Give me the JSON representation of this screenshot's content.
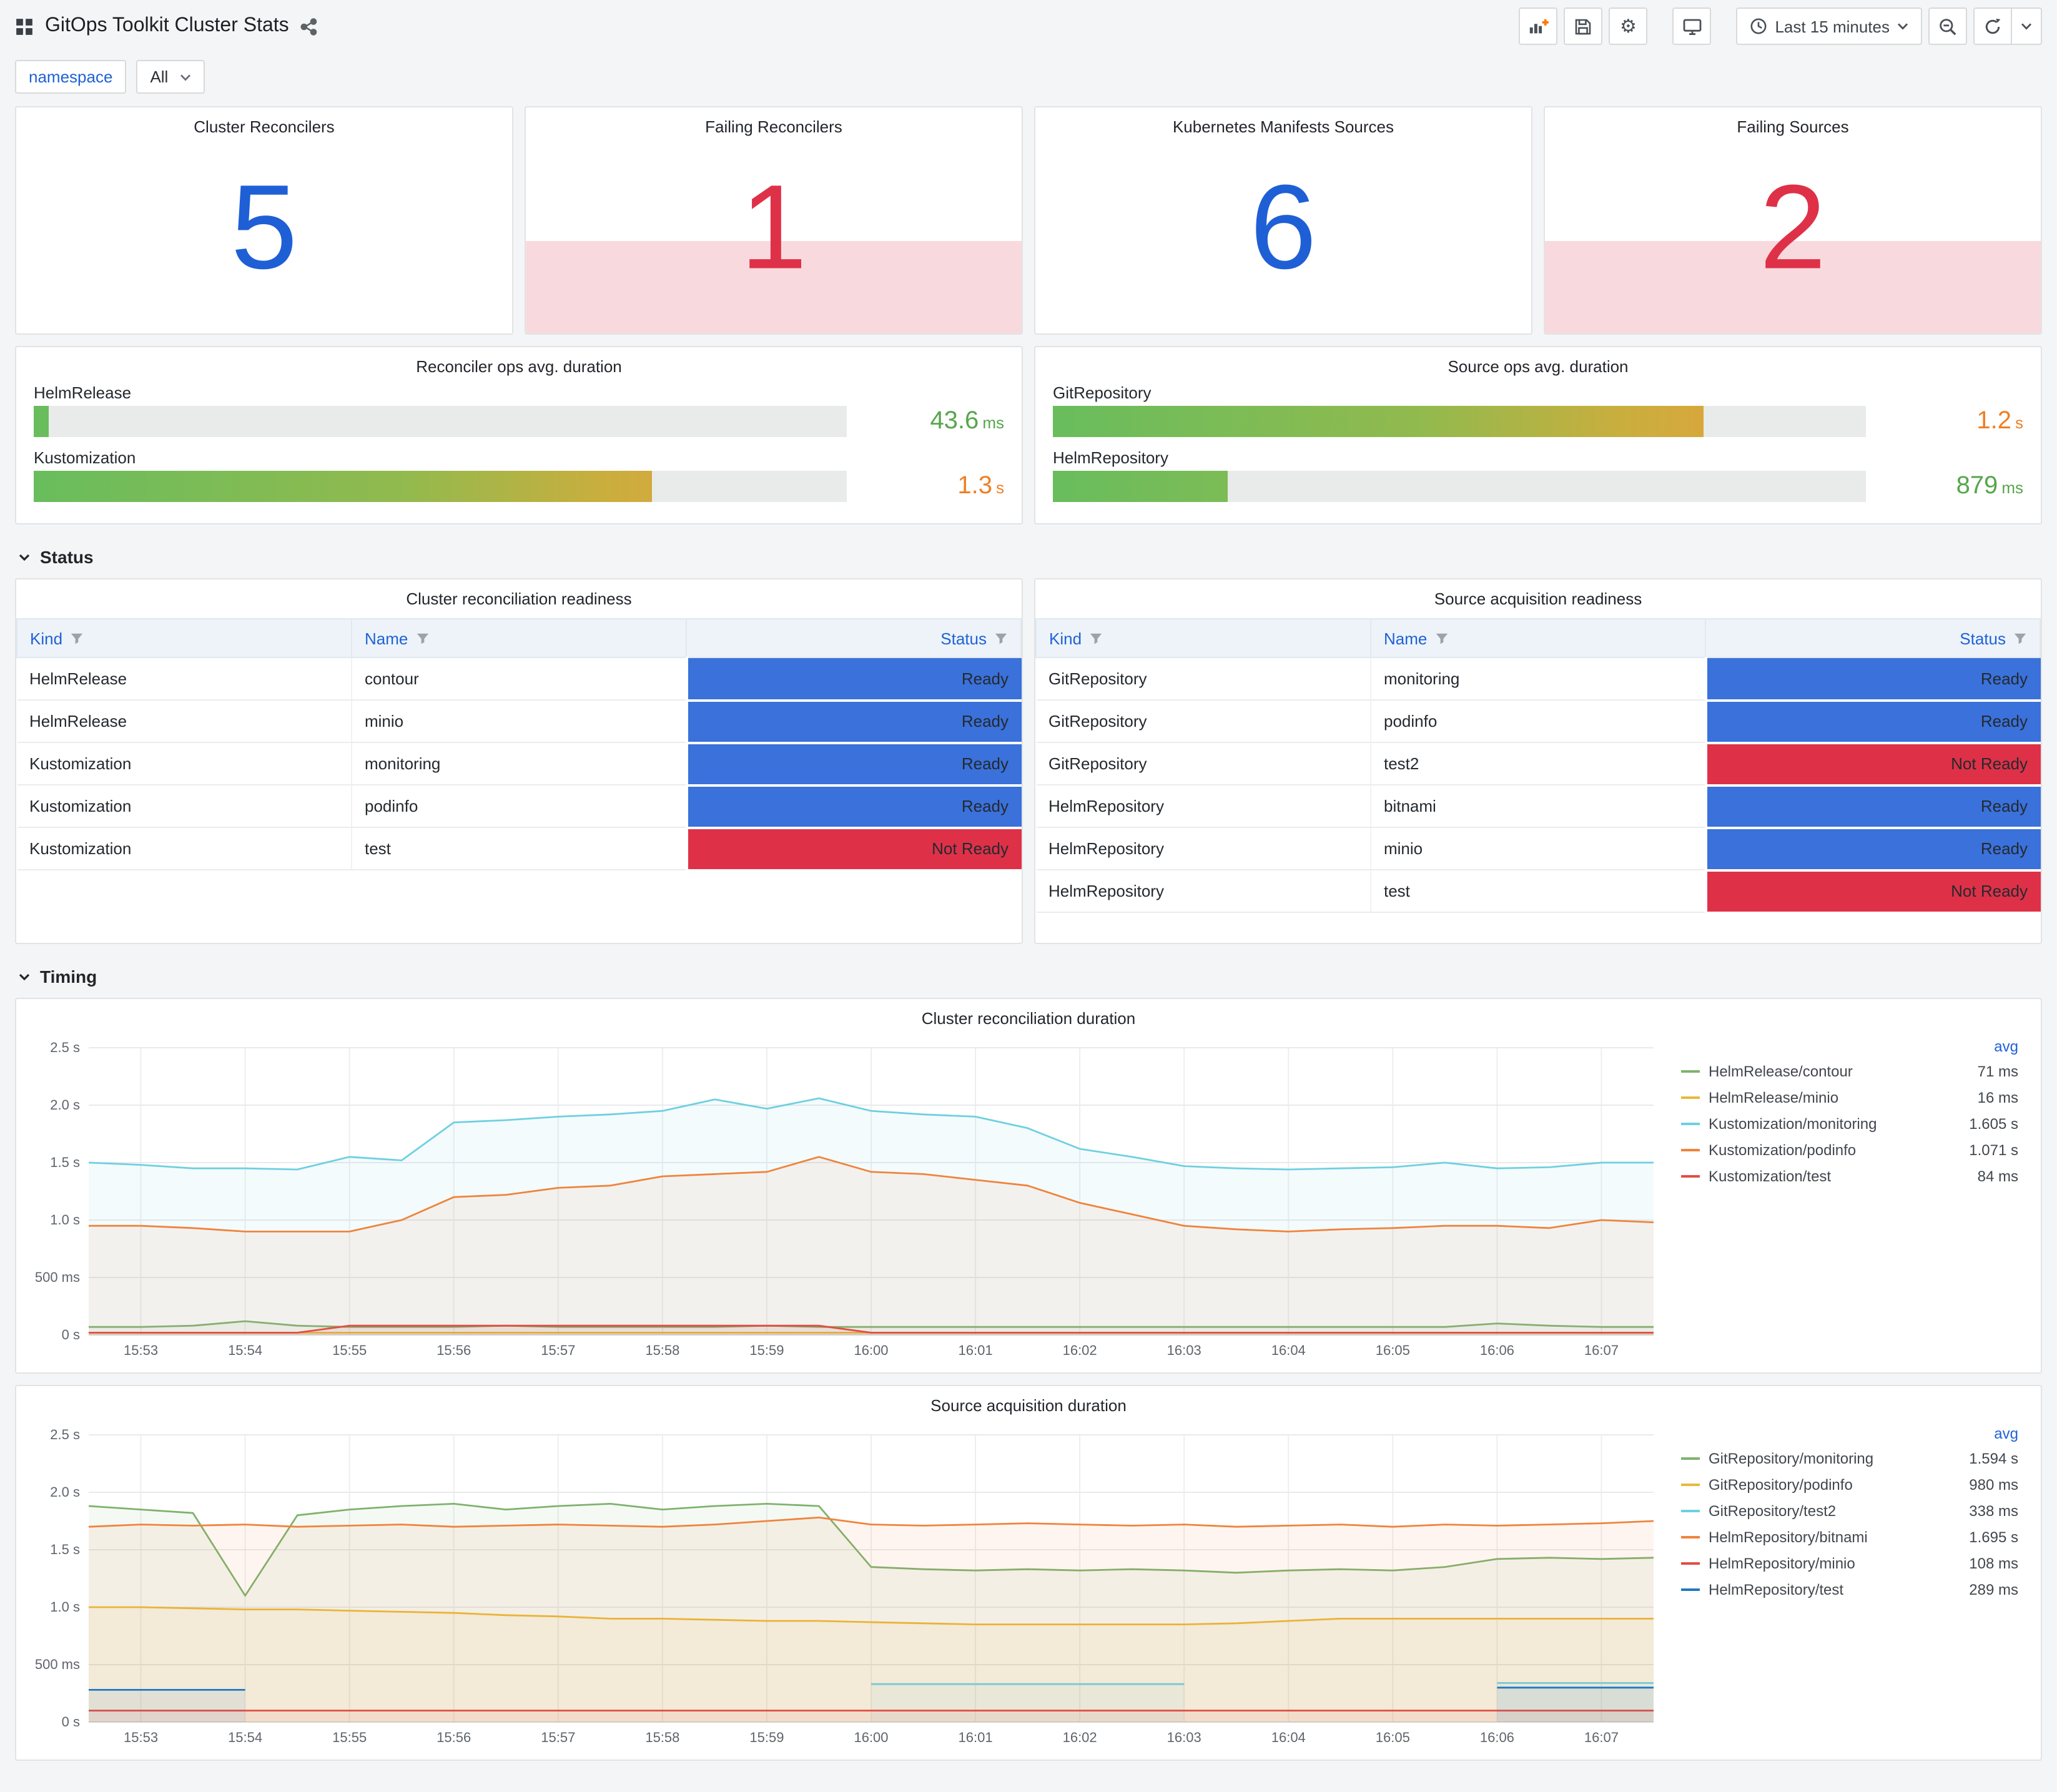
{
  "header": {
    "title": "GitOps Toolkit Cluster Stats"
  },
  "toolbar": {
    "time_range": "Last 15 minutes"
  },
  "variables": {
    "label": "namespace",
    "value": "All"
  },
  "sections": {
    "status": "Status",
    "timing": "Timing"
  },
  "colors": {
    "blue": "#1f5fd6",
    "red": "#de3148",
    "failing_bg": "#f8dade"
  },
  "status_colors": {
    "Ready": "#3a71db",
    "Not Ready": "#de3148"
  },
  "stats": [
    {
      "title": "Cluster Reconcilers",
      "value": "5",
      "color": "#1f5fd6",
      "failing": false
    },
    {
      "title": "Failing Reconcilers",
      "value": "1",
      "color": "#de3148",
      "failing": true
    },
    {
      "title": "Kubernetes Manifests Sources",
      "value": "6",
      "color": "#1f5fd6",
      "failing": false
    },
    {
      "title": "Failing Sources",
      "value": "2",
      "color": "#de3148",
      "failing": true
    }
  ],
  "gauges": [
    {
      "title": "Reconciler ops avg. duration",
      "rows": [
        {
          "label": "HelmRelease",
          "value": "43.6",
          "unit": "ms",
          "percent": 1.8,
          "value_color": "#56a64b"
        },
        {
          "label": "Kustomization",
          "value": "1.3",
          "unit": "s",
          "percent": 76,
          "value_color": "#ee7f24"
        }
      ]
    },
    {
      "title": "Source ops avg. duration",
      "rows": [
        {
          "label": "GitRepository",
          "value": "1.2",
          "unit": "s",
          "percent": 80,
          "value_color": "#ee7f24"
        },
        {
          "label": "HelmRepository",
          "value": "879",
          "unit": "ms",
          "percent": 21.5,
          "value_color": "#56a64b"
        }
      ]
    }
  ],
  "tables": [
    {
      "title": "Cluster reconciliation readiness",
      "columns": [
        "Kind",
        "Name",
        "Status"
      ],
      "rows": [
        [
          "HelmRelease",
          "contour",
          "Ready"
        ],
        [
          "HelmRelease",
          "minio",
          "Ready"
        ],
        [
          "Kustomization",
          "monitoring",
          "Ready"
        ],
        [
          "Kustomization",
          "podinfo",
          "Ready"
        ],
        [
          "Kustomization",
          "test",
          "Not Ready"
        ]
      ]
    },
    {
      "title": "Source acquisition readiness",
      "columns": [
        "Kind",
        "Name",
        "Status"
      ],
      "rows": [
        [
          "GitRepository",
          "monitoring",
          "Ready"
        ],
        [
          "GitRepository",
          "podinfo",
          "Ready"
        ],
        [
          "GitRepository",
          "test2",
          "Not Ready"
        ],
        [
          "HelmRepository",
          "bitnami",
          "Ready"
        ],
        [
          "HelmRepository",
          "minio",
          "Ready"
        ],
        [
          "HelmRepository",
          "test",
          "Not Ready"
        ]
      ]
    }
  ],
  "chart_data": [
    {
      "type": "line",
      "title": "Cluster reconciliation duration",
      "ylim": [
        0,
        2.5
      ],
      "y_ticks": [
        {
          "v": 0,
          "label": "0 s"
        },
        {
          "v": 0.5,
          "label": "500 ms"
        },
        {
          "v": 1.0,
          "label": "1.0 s"
        },
        {
          "v": 1.5,
          "label": "1.5 s"
        },
        {
          "v": 2.0,
          "label": "2.0 s"
        },
        {
          "v": 2.5,
          "label": "2.5 s"
        }
      ],
      "points_count": 31,
      "x_first_tick_index": 1,
      "x_tick_step": 2,
      "x_tick_labels": [
        "15:53",
        "15:54",
        "15:55",
        "15:56",
        "15:57",
        "15:58",
        "15:59",
        "16:00",
        "16:01",
        "16:02",
        "16:03",
        "16:04",
        "16:05",
        "16:06",
        "16:07"
      ],
      "legend_header": "avg",
      "series": [
        {
          "name": "HelmRelease/contour",
          "color": "#7EB26D",
          "avg": "71 ms",
          "values": [
            0.07,
            0.07,
            0.08,
            0.12,
            0.08,
            0.07,
            0.07,
            0.07,
            0.08,
            0.07,
            0.07,
            0.07,
            0.07,
            0.08,
            0.07,
            0.07,
            0.07,
            0.07,
            0.07,
            0.07,
            0.07,
            0.07,
            0.07,
            0.07,
            0.07,
            0.07,
            0.07,
            0.1,
            0.08,
            0.07,
            0.07
          ]
        },
        {
          "name": "HelmRelease/minio",
          "color": "#EAB839",
          "avg": "16 ms",
          "values": [
            0.02,
            0.02,
            0.02,
            0.02,
            0.02,
            0.02,
            0.02,
            0.02,
            0.02,
            0.02,
            0.02,
            0.02,
            0.02,
            0.02,
            0.02,
            0.02,
            0.02,
            0.02,
            0.02,
            0.02,
            0.02,
            0.02,
            0.02,
            0.02,
            0.02,
            0.02,
            0.02,
            0.02,
            0.02,
            0.02,
            0.02
          ]
        },
        {
          "name": "Kustomization/monitoring",
          "color": "#6ED0E0",
          "avg": "1.605 s",
          "values": [
            1.5,
            1.48,
            1.45,
            1.45,
            1.44,
            1.55,
            1.52,
            1.85,
            1.87,
            1.9,
            1.92,
            1.95,
            2.05,
            1.97,
            2.06,
            1.95,
            1.92,
            1.9,
            1.8,
            1.62,
            1.55,
            1.47,
            1.45,
            1.44,
            1.45,
            1.46,
            1.5,
            1.45,
            1.46,
            1.5,
            1.5
          ]
        },
        {
          "name": "Kustomization/podinfo",
          "color": "#EF843C",
          "avg": "1.071 s",
          "values": [
            0.95,
            0.95,
            0.93,
            0.9,
            0.9,
            0.9,
            1.0,
            1.2,
            1.22,
            1.28,
            1.3,
            1.38,
            1.4,
            1.42,
            1.55,
            1.42,
            1.4,
            1.35,
            1.3,
            1.15,
            1.05,
            0.95,
            0.92,
            0.9,
            0.92,
            0.93,
            0.95,
            0.95,
            0.93,
            1.0,
            0.98
          ]
        },
        {
          "name": "Kustomization/test",
          "color": "#E24D42",
          "avg": "84 ms",
          "values": [
            0.02,
            0.02,
            0.02,
            0.02,
            0.02,
            0.08,
            0.08,
            0.08,
            0.08,
            0.08,
            0.08,
            0.08,
            0.08,
            0.08,
            0.08,
            0.02,
            0.02,
            0.02,
            0.02,
            0.02,
            0.02,
            0.02,
            0.02,
            0.02,
            0.02,
            0.02,
            0.02,
            0.02,
            0.02,
            0.02,
            0.02
          ]
        }
      ]
    },
    {
      "type": "line",
      "title": "Source acquisition duration",
      "ylim": [
        0,
        2.5
      ],
      "y_ticks": [
        {
          "v": 0,
          "label": "0 s"
        },
        {
          "v": 0.5,
          "label": "500 ms"
        },
        {
          "v": 1.0,
          "label": "1.0 s"
        },
        {
          "v": 1.5,
          "label": "1.5 s"
        },
        {
          "v": 2.0,
          "label": "2.0 s"
        },
        {
          "v": 2.5,
          "label": "2.5 s"
        }
      ],
      "points_count": 31,
      "x_first_tick_index": 1,
      "x_tick_step": 2,
      "x_tick_labels": [
        "15:53",
        "15:54",
        "15:55",
        "15:56",
        "15:57",
        "15:58",
        "15:59",
        "16:00",
        "16:01",
        "16:02",
        "16:03",
        "16:04",
        "16:05",
        "16:06",
        "16:07"
      ],
      "legend_header": "avg",
      "series": [
        {
          "name": "GitRepository/monitoring",
          "color": "#7EB26D",
          "avg": "1.594 s",
          "values": [
            1.88,
            1.85,
            1.82,
            1.1,
            1.8,
            1.85,
            1.88,
            1.9,
            1.85,
            1.88,
            1.9,
            1.85,
            1.88,
            1.9,
            1.88,
            1.35,
            1.33,
            1.32,
            1.33,
            1.32,
            1.33,
            1.32,
            1.3,
            1.32,
            1.33,
            1.32,
            1.35,
            1.42,
            1.43,
            1.42,
            1.43
          ]
        },
        {
          "name": "GitRepository/podinfo",
          "color": "#EAB839",
          "avg": "980 ms",
          "values": [
            1.0,
            1.0,
            0.99,
            0.98,
            0.98,
            0.97,
            0.96,
            0.95,
            0.93,
            0.92,
            0.9,
            0.9,
            0.89,
            0.88,
            0.88,
            0.87,
            0.86,
            0.85,
            0.85,
            0.85,
            0.85,
            0.85,
            0.86,
            0.88,
            0.9,
            0.9,
            0.9,
            0.9,
            0.9,
            0.9,
            0.9
          ]
        },
        {
          "name": "GitRepository/test2",
          "color": "#6ED0E0",
          "avg": "338 ms",
          "values": [
            null,
            null,
            null,
            null,
            null,
            null,
            null,
            null,
            null,
            null,
            null,
            null,
            null,
            null,
            null,
            0.33,
            0.33,
            0.33,
            0.33,
            0.33,
            0.33,
            0.33,
            null,
            null,
            null,
            null,
            null,
            0.34,
            0.34,
            0.34,
            0.34
          ]
        },
        {
          "name": "HelmRepository/bitnami",
          "color": "#EF843C",
          "avg": "1.695 s",
          "values": [
            1.7,
            1.72,
            1.71,
            1.72,
            1.7,
            1.71,
            1.72,
            1.7,
            1.71,
            1.72,
            1.71,
            1.7,
            1.72,
            1.75,
            1.78,
            1.72,
            1.71,
            1.72,
            1.73,
            1.72,
            1.71,
            1.72,
            1.7,
            1.71,
            1.72,
            1.7,
            1.72,
            1.71,
            1.72,
            1.73,
            1.75
          ]
        },
        {
          "name": "HelmRepository/minio",
          "color": "#E24D42",
          "avg": "108 ms",
          "values": [
            0.1,
            0.1,
            0.1,
            0.1,
            0.1,
            0.1,
            0.1,
            0.1,
            0.1,
            0.1,
            0.1,
            0.1,
            0.1,
            0.1,
            0.1,
            0.1,
            0.1,
            0.1,
            0.1,
            0.1,
            0.1,
            0.1,
            0.1,
            0.1,
            0.1,
            0.1,
            0.1,
            0.1,
            0.1,
            0.1,
            0.1
          ]
        },
        {
          "name": "HelmRepository/test",
          "color": "#1F78C1",
          "avg": "289 ms",
          "values": [
            0.28,
            0.28,
            0.28,
            0.28,
            null,
            null,
            null,
            null,
            null,
            null,
            null,
            null,
            null,
            null,
            null,
            null,
            null,
            null,
            null,
            null,
            null,
            null,
            null,
            null,
            null,
            null,
            null,
            0.3,
            0.3,
            0.3,
            0.3
          ]
        }
      ]
    }
  ]
}
